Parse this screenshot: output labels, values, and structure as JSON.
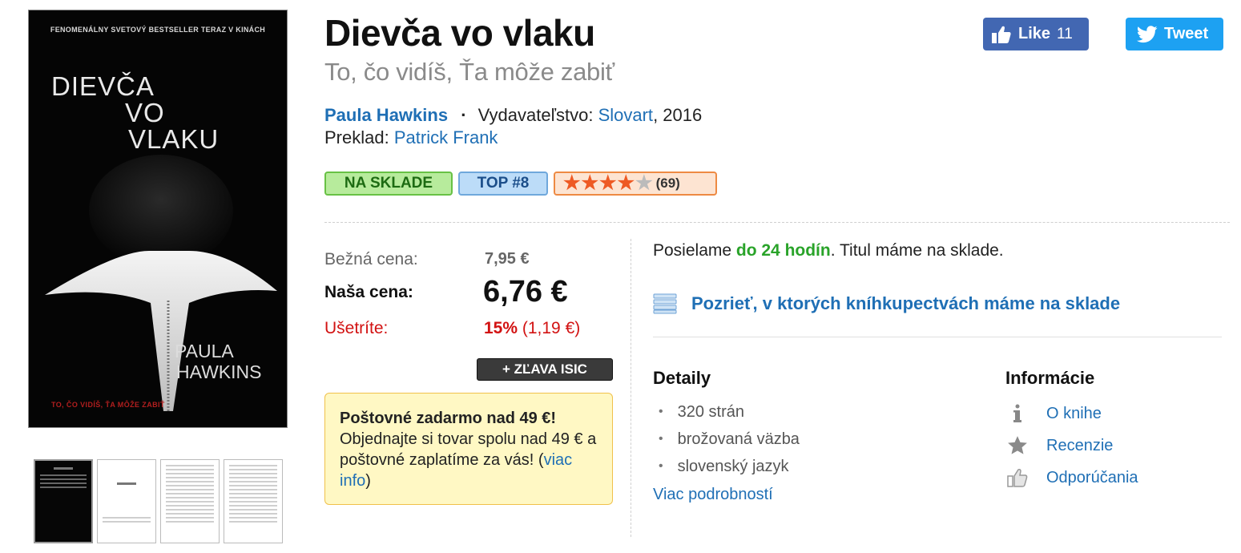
{
  "cover": {
    "tagline": "FENOMENÁLNY SVETOVÝ BESTSELLER TERAZ V KINÁCH",
    "title_lines": [
      "DIEVČA",
      "VO",
      "VLAKU"
    ],
    "author_lines": [
      "PAULA",
      "HAWKINS"
    ],
    "subtitle": "TO, ČO VIDÍŠ, ŤA MÔŽE ZABIŤ"
  },
  "thumbnails": [
    {
      "label": "",
      "active": true
    },
    {
      "label": "",
      "active": false
    },
    {
      "label": "",
      "active": false
    },
    {
      "label": "",
      "active": false
    }
  ],
  "book": {
    "title": "Dievča vo vlaku",
    "subtitle": "To, čo vidíš, Ťa môže zabiť",
    "author": "Paula Hawkins",
    "separator": "·",
    "publisher_label": "Vydavateľstvo:",
    "publisher": "Slovart",
    "year": ", 2016",
    "translation_label": "Preklad:",
    "translator": "Patrick Frank"
  },
  "social": {
    "like_label": "Like",
    "like_count": "11",
    "tweet_label": "Tweet"
  },
  "badges": {
    "stock": "NA SKLADE",
    "top": "TOP #8",
    "rating_value": 4,
    "rating_max": 5,
    "rating_count": "(69)"
  },
  "price": {
    "regular_label": "Bežná cena:",
    "regular_value": "7,95 €",
    "our_label": "Naša cena:",
    "our_value": "6,76 €",
    "save_label": "Ušetríte:",
    "save_percent": "15%",
    "save_amount": " (1,19 €)",
    "isic_button": "+ ZĽAVA ISIC"
  },
  "shipping": {
    "heading": "Poštovné zadarmo nad 49 €!",
    "text": "Objednajte si tovar spolu nad 49 € a poštovné zaplatíme za vás!",
    "link_open": "(",
    "link": "viac info",
    "link_close": ")"
  },
  "delivery": {
    "prefix": "Posielame ",
    "highlight": "do 24 hodín",
    "suffix": ". Titul máme na sklade."
  },
  "stores_link": "Pozrieť, v ktorých kníhkupectvách máme na sklade",
  "details": {
    "heading": "Detaily",
    "items": [
      "320 strán",
      "brožovaná väzba",
      "slovenský jazyk"
    ],
    "more": "Viac podrobností"
  },
  "info": {
    "heading": "Informácie",
    "items": [
      {
        "icon": "info-icon",
        "label": "O knihe"
      },
      {
        "icon": "star-icon",
        "label": "Recenzie"
      },
      {
        "icon": "thumbs-up-icon",
        "label": "Odporúčania"
      }
    ]
  },
  "colors": {
    "link": "#1f6fb5",
    "green": "#29a329",
    "red": "#d21212",
    "facebook": "#4267b2",
    "twitter": "#1da1f2"
  }
}
